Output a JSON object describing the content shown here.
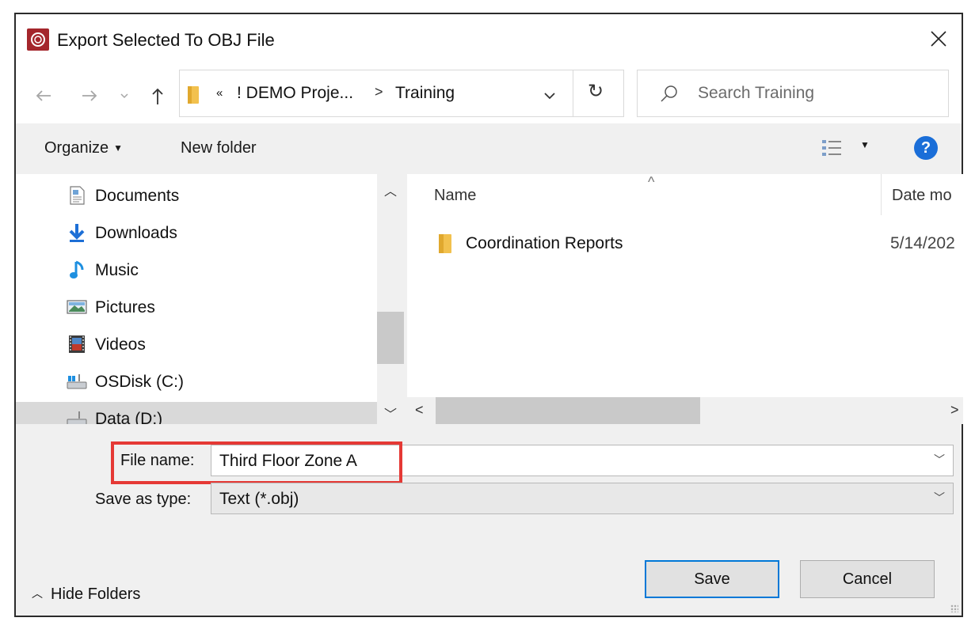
{
  "window": {
    "title": "Export Selected To OBJ File",
    "app_icon": "revit-app-icon",
    "close_icon": "close-icon"
  },
  "navigation": {
    "back_icon": "arrow-left-icon",
    "forward_icon": "arrow-right-icon",
    "recent_icon": "chevron-down-icon",
    "up_icon": "arrow-up-icon",
    "breadcrumb": {
      "overflow": "«",
      "segments": [
        "! DEMO Proje...",
        "Training"
      ],
      "separator": ">"
    },
    "refresh_glyph": "↻",
    "search_placeholder": "Search Training"
  },
  "toolbar": {
    "organize_label": "Organize",
    "new_folder_label": "New folder",
    "view_icon": "view-details-icon",
    "help_label": "?"
  },
  "nav_pane": {
    "items": [
      {
        "label": "Documents",
        "icon": "documents-icon"
      },
      {
        "label": "Downloads",
        "icon": "downloads-icon"
      },
      {
        "label": "Music",
        "icon": "music-icon"
      },
      {
        "label": "Pictures",
        "icon": "pictures-icon"
      },
      {
        "label": "Videos",
        "icon": "videos-icon"
      },
      {
        "label": "OSDisk (C:)",
        "icon": "drive-icon"
      },
      {
        "label": "Data (D:)",
        "icon": "drive-icon"
      }
    ],
    "selected": "Data (D:)"
  },
  "file_list": {
    "columns": [
      "Name",
      "Date mo"
    ],
    "rows": [
      {
        "name": "Coordination Reports",
        "date": "5/14/202",
        "icon": "folder-icon"
      }
    ]
  },
  "form": {
    "file_name_label": "File name:",
    "file_name_value": "Third Floor Zone A",
    "save_type_label": "Save as type:",
    "save_type_value": "Text (*.obj)"
  },
  "footer": {
    "hide_folders_label": "Hide Folders",
    "save_label": "Save",
    "cancel_label": "Cancel"
  },
  "colors": {
    "accent": "#0078d7",
    "highlight": "#e53935",
    "app_icon_bg": "#a4262c",
    "folder": "#f2c14e"
  }
}
